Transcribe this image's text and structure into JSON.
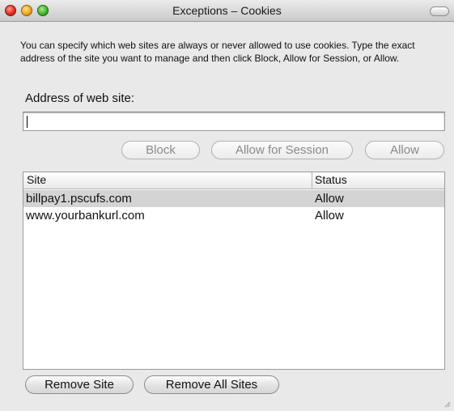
{
  "window": {
    "title": "Exceptions – Cookies"
  },
  "description": "You can specify which web sites are always or never allowed to use cookies. Type the exact address of the site you want to manage and then click Block, Allow for Session, or Allow.",
  "address": {
    "label": "Address of web site:",
    "value": ""
  },
  "actions": {
    "block": "Block",
    "allow_session": "Allow for Session",
    "allow": "Allow"
  },
  "table": {
    "headers": {
      "site": "Site",
      "status": "Status"
    },
    "rows": [
      {
        "site": "billpay1.pscufs.com",
        "status": "Allow",
        "selected": true
      },
      {
        "site": "www.yourbankurl.com",
        "status": "Allow",
        "selected": false
      }
    ]
  },
  "footer": {
    "remove_site": "Remove Site",
    "remove_all": "Remove All Sites"
  }
}
